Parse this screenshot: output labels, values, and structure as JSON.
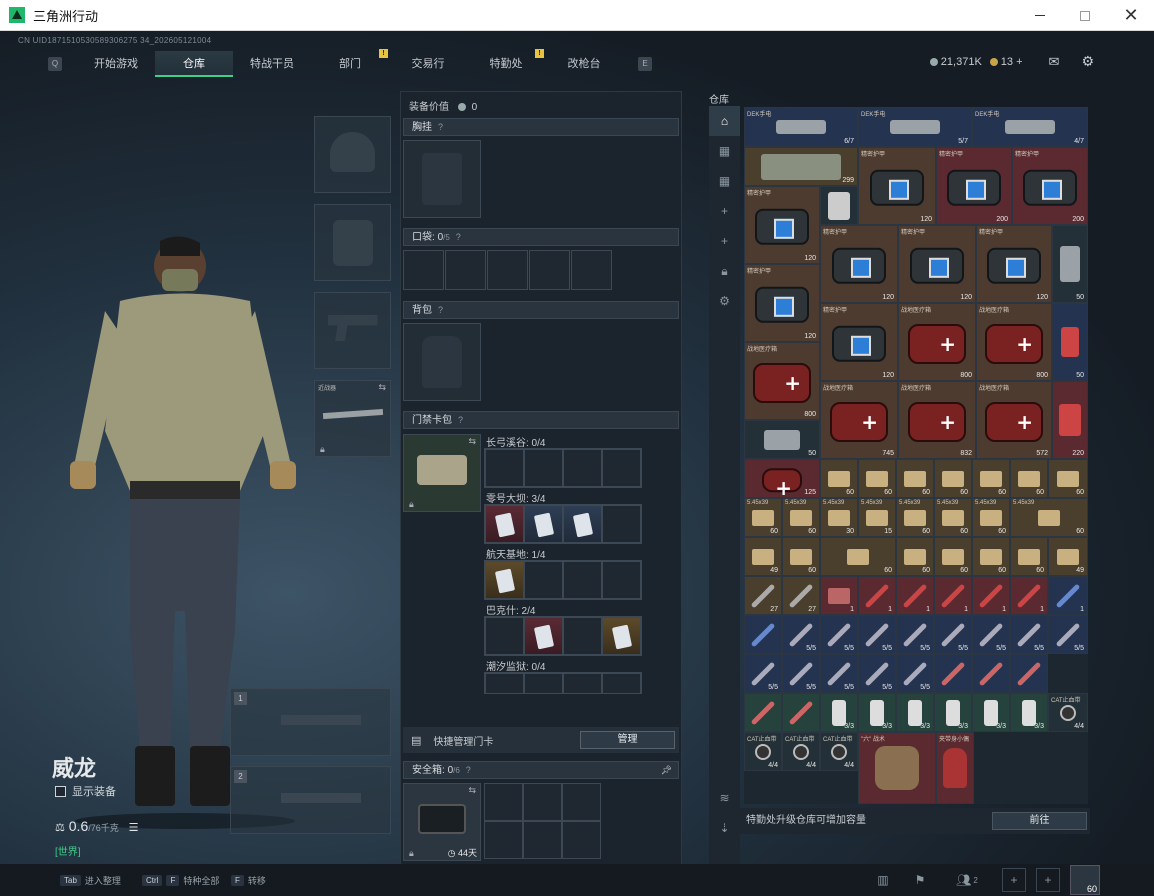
{
  "window": {
    "title": "三角洲行动"
  },
  "uid": "CN UID1871510530589306275 34_202605121004",
  "nav": {
    "left_key": "Q",
    "right_key": "E",
    "tabs": [
      {
        "label": "开始游戏"
      },
      {
        "label": "仓库",
        "active": true
      },
      {
        "label": "特战干员"
      },
      {
        "label": "部门",
        "alert": "!"
      },
      {
        "label": "交易行"
      },
      {
        "label": "特勤处",
        "alert": "!"
      },
      {
        "label": "改枪台"
      }
    ]
  },
  "currency": {
    "silver": "21,371K",
    "gold": "13",
    "plus": "+"
  },
  "character": {
    "name": "威龙",
    "show_equip": "显示装备",
    "weight": "0.6",
    "weight_max": "/76千克",
    "chat_tag": "[世界]"
  },
  "weapon_slot_indices": [
    "1",
    "2"
  ],
  "melee_label": "近战器",
  "mid": {
    "equip_value_label": "装备价值",
    "equip_value": "0",
    "chest_rig": "胸挂",
    "pocket": "口袋",
    "pocket_count": "0",
    "pocket_max": "/5",
    "backpack": "背包",
    "keycard_case": "门禁卡包",
    "help": "?",
    "maps": [
      {
        "label": "长弓溪谷: 0/4"
      },
      {
        "label": "零号大坝: 3/4"
      },
      {
        "label": "航天基地: 1/4"
      },
      {
        "label": "巴克什: 2/4"
      },
      {
        "label": "潮汐监狱: 0/4"
      }
    ],
    "quick_manage_label": "快捷管理门卡",
    "manage_button": "管理",
    "safe_box": "安全箱",
    "safe_count": "0",
    "safe_max": "/6",
    "safe_days": "44天"
  },
  "warehouse": {
    "label": "仓库",
    "footer_text": "特勤处升级仓库可增加容量",
    "goto_button": "前往",
    "row1_labels": [
      "DEK手电",
      "DEK手电",
      "DEK手电"
    ],
    "row1_counts": [
      "6/7",
      "5/7",
      "4/7"
    ],
    "bag_label": "精密护甲",
    "med_label": "战地医疗箱",
    "counts_a": [
      "299",
      "120",
      "200",
      "200",
      "120"
    ],
    "counts_b": [
      "120",
      "120",
      "120",
      "120",
      "50"
    ],
    "counts_c": [
      "120",
      "120",
      "800",
      "800",
      "50"
    ],
    "counts_d": [
      "800",
      "745",
      "832",
      "572",
      "220"
    ],
    "counts_e": [
      "50",
      "125",
      "60",
      "60",
      "60",
      "60",
      "60",
      "60",
      "60"
    ],
    "ammo_label": "5.45x39",
    "ammo_row": [
      "60",
      "60",
      "30",
      "15",
      "60",
      "60",
      "60",
      "60"
    ],
    "ammo_row2": [
      "49",
      "60",
      "60",
      "60",
      "60",
      "60",
      "60",
      "49"
    ],
    "inj_counts": [
      "27",
      "27",
      "1",
      "1",
      "1",
      "1",
      "1",
      "1",
      "1"
    ],
    "item_count_5": "5/5",
    "item_count_3": "3/3",
    "item_count_4": "4/4",
    "cat_label": "CAT止血带",
    "gloves_label": "\"六\" 战术",
    "last_label": "夹带身小偶"
  },
  "bottom": {
    "hints": [
      {
        "key": "Tab",
        "text": "进入整理"
      },
      {
        "key": "Ctrl",
        "key2": "F",
        "text": "特种全部"
      },
      {
        "key": "F",
        "text": "转移"
      }
    ],
    "friend_count": "2",
    "avatar_level": "60"
  }
}
